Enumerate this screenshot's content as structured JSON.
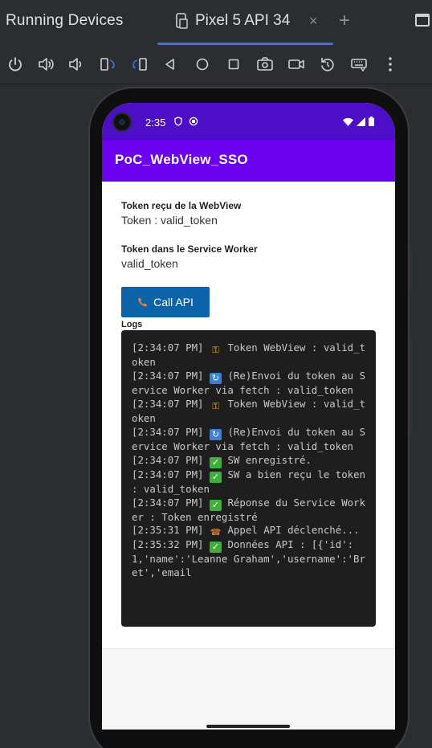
{
  "panel": {
    "title": "Running Devices"
  },
  "tab": {
    "label": "Pixel 5 API 34",
    "close": "×",
    "add": "+"
  },
  "toolbar": {
    "buttons": [
      "power-icon",
      "volume-up-icon",
      "volume-down-icon",
      "rotate-left-icon",
      "rotate-right-icon",
      "back-icon",
      "home-icon",
      "overview-icon",
      "screenshot-icon",
      "screen-record-icon",
      "reset-icon",
      "keyboard-icon",
      "more-icon"
    ]
  },
  "device": {
    "status": {
      "time": "2:35"
    },
    "app_title": "PoC_WebView_SSO",
    "webview_token": {
      "label": "Token reçu de la WebView",
      "value": "Token : valid_token"
    },
    "sw_token": {
      "label": "Token dans le Service Worker",
      "value": "valid_token"
    },
    "call_button": {
      "label": "Call API"
    },
    "logs_label": "Logs",
    "logs": [
      {
        "time": "[2:34:07 PM]",
        "icon": "key",
        "text": "Token WebView : valid_token"
      },
      {
        "time": "[2:34:07 PM]",
        "icon": "refresh",
        "text": "(Re)Envoi du token au Service Worker via fetch : valid_token"
      },
      {
        "time": "[2:34:07 PM]",
        "icon": "key",
        "text": "Token WebView : valid_token"
      },
      {
        "time": "[2:34:07 PM]",
        "icon": "refresh",
        "text": "(Re)Envoi du token au Service Worker via fetch : valid_token"
      },
      {
        "time": "[2:34:07 PM]",
        "icon": "check",
        "text": "SW enregistré."
      },
      {
        "time": "[2:34:07 PM]",
        "icon": "check",
        "text": "SW a bien reçu le token : valid_token"
      },
      {
        "time": "[2:34:07 PM]",
        "icon": "check",
        "text": "Réponse du Service Worker : Token enregistré"
      },
      {
        "time": "[2:35:31 PM]",
        "icon": "phone",
        "text": "Appel API déclenché..."
      },
      {
        "time": "[2:35:32 PM]",
        "icon": "check",
        "text": "Données API : [{'id':1,'name':'Leanne Graham','username':'Bret','email"
      }
    ]
  },
  "colors": {
    "status_bar": "#4c0fc7",
    "app_bar": "#6a00ee",
    "button": "#0d63aa",
    "tab_accent": "#3574f0"
  }
}
